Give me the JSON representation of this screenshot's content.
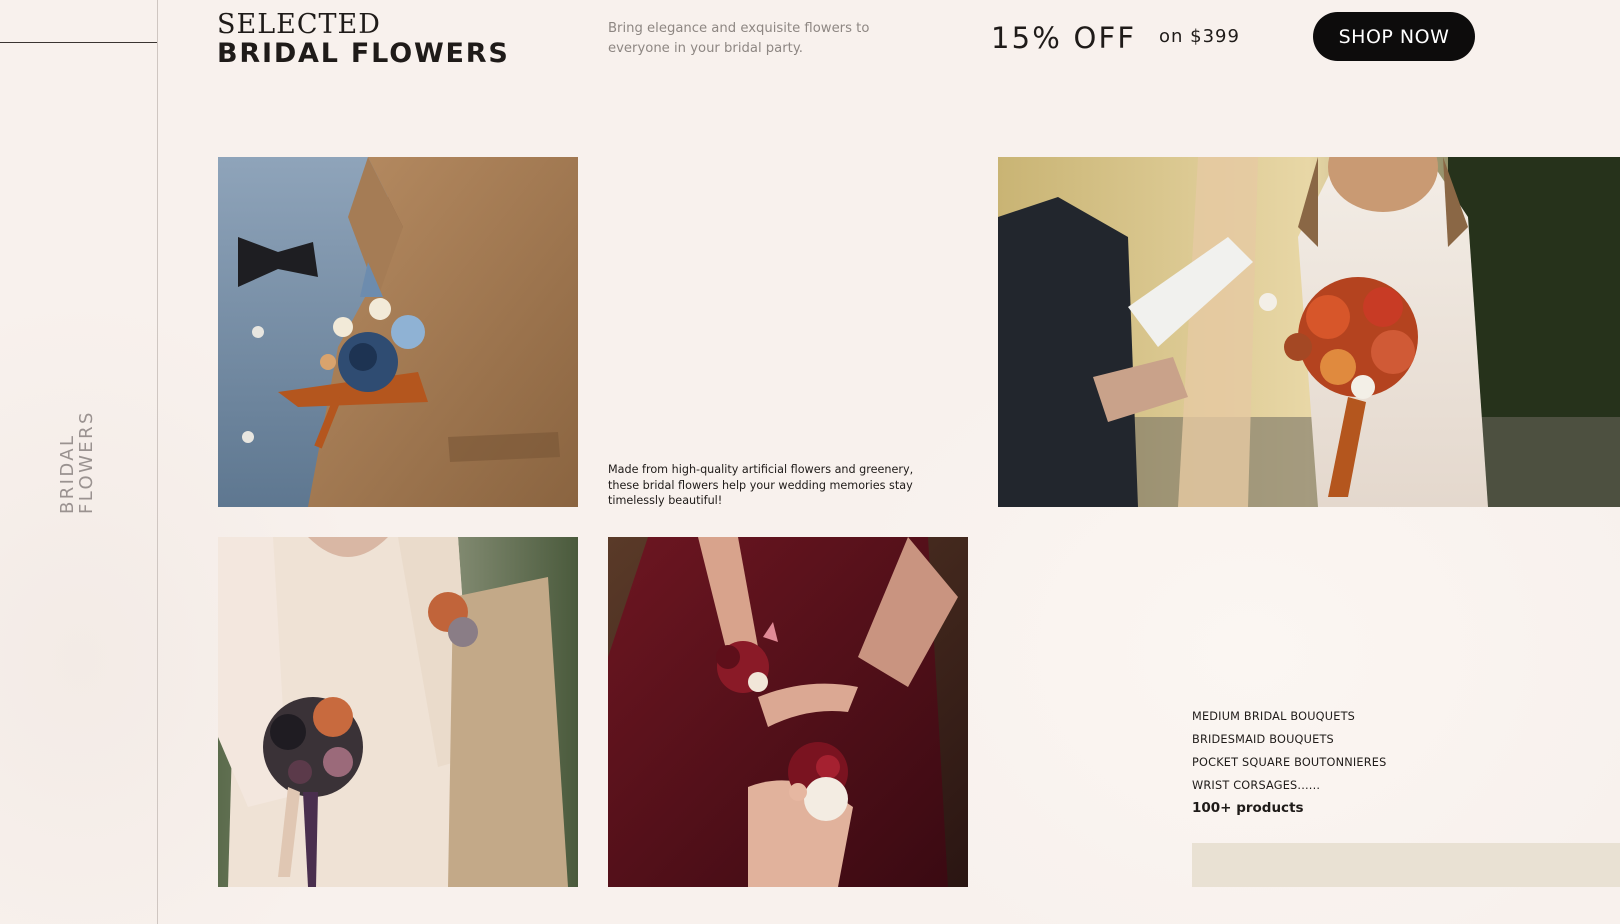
{
  "sidebar": {
    "vertical_label_line1": "BRIDAL",
    "vertical_label_line2": "FLOWERS"
  },
  "header": {
    "title_line1": "SELECTED",
    "title_line2": "BRIDAL FLOWERS",
    "tagline": "Bring elegance and exquisite flowers to everyone in your bridal party.",
    "promo_discount": "15% OFF",
    "promo_condition": "on $399",
    "shop_button": "SHOP NOW"
  },
  "main": {
    "description": "Made from high-quality artificial flowers and greenery, these bridal flowers help your wedding memories stay timelessly beautiful!",
    "categories": [
      "MEDIUM BRIDAL BOUQUETS",
      "BRIDESMAID BOUQUETS",
      "POCKET SQUARE BOUTONNIERES",
      "WRIST CORSAGES......"
    ],
    "product_count": "100+ products"
  },
  "colors": {
    "background": "#f8f1ed",
    "button": "#0d0c0c",
    "accent_bar": "#e9e1d3",
    "text": "#1f1b19",
    "muted_text": "#8e8783"
  }
}
